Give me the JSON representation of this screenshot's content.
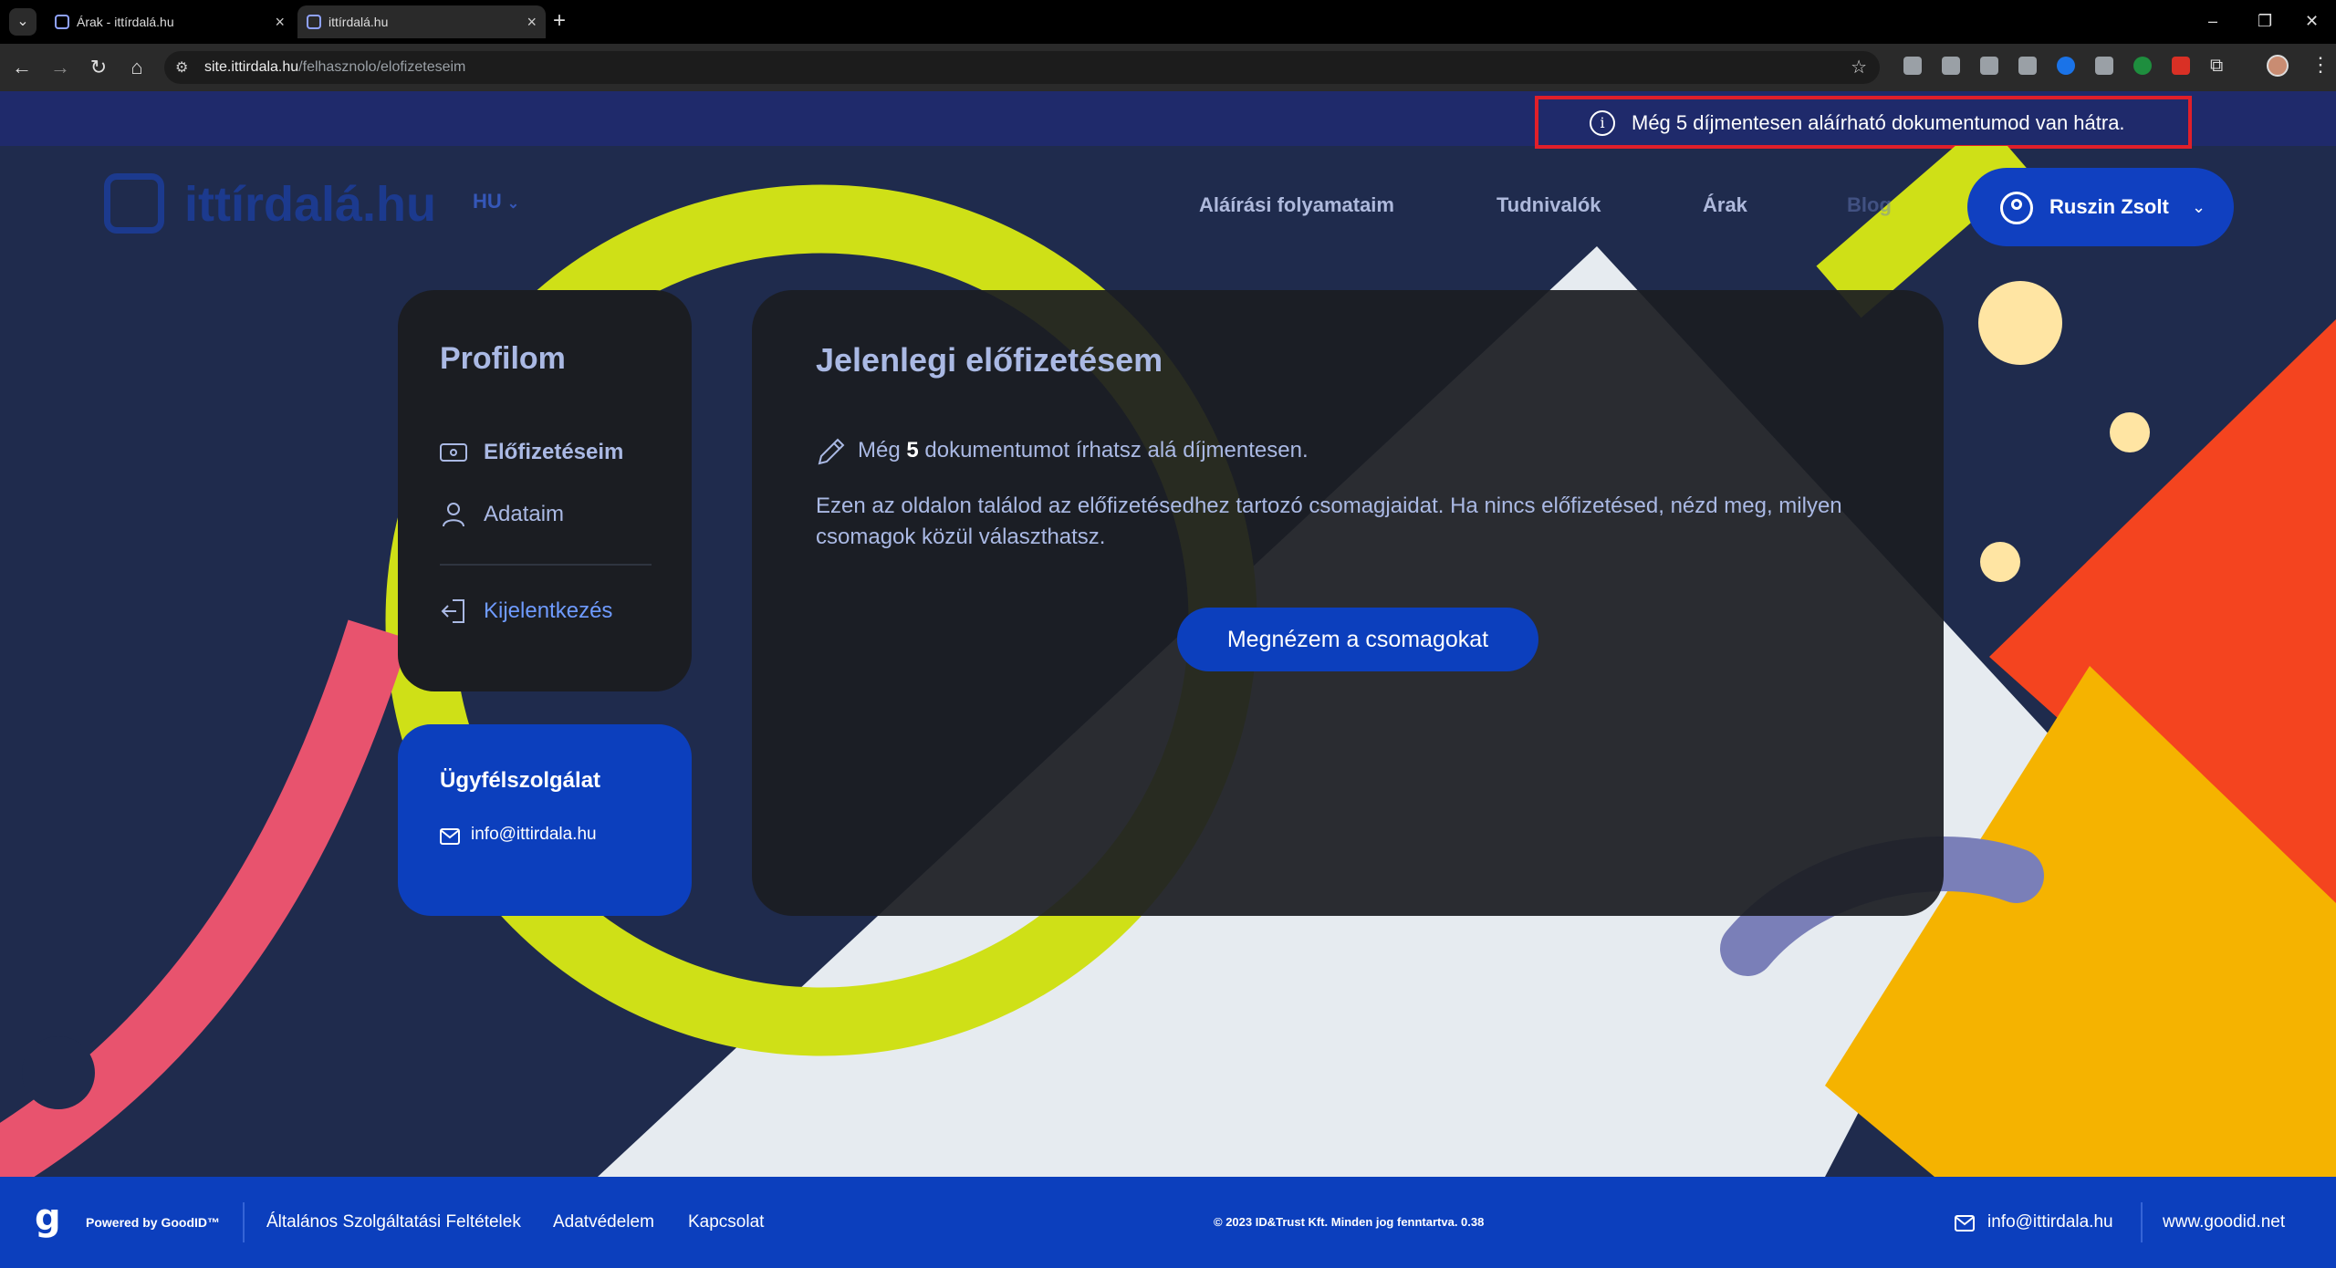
{
  "browser": {
    "tabs": [
      {
        "title": "Árak - ittírdalá.hu",
        "active": false
      },
      {
        "title": "ittírdalá.hu",
        "active": true
      }
    ],
    "url_host": "site.ittirdala.hu",
    "url_path": "/felhasznolo/elofizeteseim"
  },
  "notice": {
    "icon": "info-icon",
    "text": "Még 5 díjmentesen aláírható dokumentumod van hátra."
  },
  "header": {
    "logo_text": "ittírdalá.hu",
    "language": "HU",
    "nav": [
      {
        "label": "Aláírási folyamataim"
      },
      {
        "label": "Tudnivalók"
      },
      {
        "label": "Árak"
      },
      {
        "label": "Blog"
      }
    ],
    "user_name": "Ruszin Zsolt"
  },
  "profile": {
    "title": "Profilom",
    "menu": [
      {
        "label": "Előfizetéseim",
        "icon": "ticket-icon",
        "active": true
      },
      {
        "label": "Adataim",
        "icon": "user-icon",
        "active": false
      },
      {
        "label": "Kijelentkezés",
        "icon": "logout-icon",
        "active": false
      }
    ]
  },
  "support": {
    "title": "Ügyfélszolgálat",
    "email": "info@ittirdala.hu"
  },
  "subscription": {
    "title": "Jelenlegi előfizetésem",
    "free_prefix": "Még",
    "free_count": "5",
    "free_suffix": "dokumentumot írhatsz alá díjmentesen.",
    "description": "Ezen az oldalon találod az előfizetésedhez tartozó csomagjaidat. Ha nincs előfizetésed, nézd meg, milyen csomagok közül választhatsz.",
    "cta_label": "Megnézem a csomagokat"
  },
  "footer": {
    "powered_by": "Powered by GoodID™",
    "links": [
      {
        "label": "Általános Szolgáltatási Feltételek"
      },
      {
        "label": "Adatvédelem"
      },
      {
        "label": "Kapcsolat"
      }
    ],
    "copyright": "© 2023 ID&Trust Kft. Minden jog fenntartva. 0.38",
    "email": "info@ittirdala.hu",
    "website": "www.goodid.net"
  },
  "colors": {
    "page_bg": "#1f2b4d",
    "notice_bg": "#1f2a6b",
    "highlight_border": "#e01f2a",
    "primary_blue": "#0c3fbd",
    "card_bg": "#1b1d22",
    "text_muted": "#aab9e4",
    "accent_lime": "#cfe017",
    "accent_pink": "#e8536e",
    "accent_red": "#f4441f",
    "accent_yellow": "#f5b300"
  }
}
